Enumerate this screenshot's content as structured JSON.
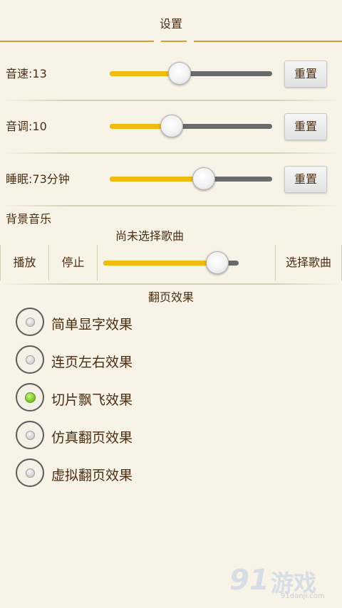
{
  "header": {
    "title": "设置"
  },
  "speed": {
    "label": "音速:13",
    "value_fraction": 0.43,
    "reset_label": "重置"
  },
  "pitch": {
    "label": "音调:10",
    "value_fraction": 0.38,
    "reset_label": "重置"
  },
  "sleep": {
    "label": "睡眠:73分钟",
    "value_fraction": 0.58,
    "reset_label": "重置"
  },
  "bgm": {
    "title": "背景音乐",
    "song": "尚未选择歌曲",
    "play_label": "播放",
    "stop_label": "停止",
    "volume_fraction": 0.84,
    "choose_label": "选择歌曲"
  },
  "flip": {
    "title": "翻页效果",
    "options": [
      {
        "label": "简单显字效果",
        "checked": false
      },
      {
        "label": "连页左右效果",
        "checked": false
      },
      {
        "label": "切片飘飞效果",
        "checked": true
      },
      {
        "label": "仿真翻页效果",
        "checked": false
      },
      {
        "label": "虚拟翻页效果",
        "checked": false
      }
    ]
  },
  "watermark": {
    "brand": "91",
    "name": "游戏",
    "url": "91danji.com"
  },
  "colors": {
    "accent": "#d89a3a",
    "slider_fill": "#f2bc0e",
    "radio_checked": "#7dc82a",
    "background": "#f7f3e6"
  }
}
